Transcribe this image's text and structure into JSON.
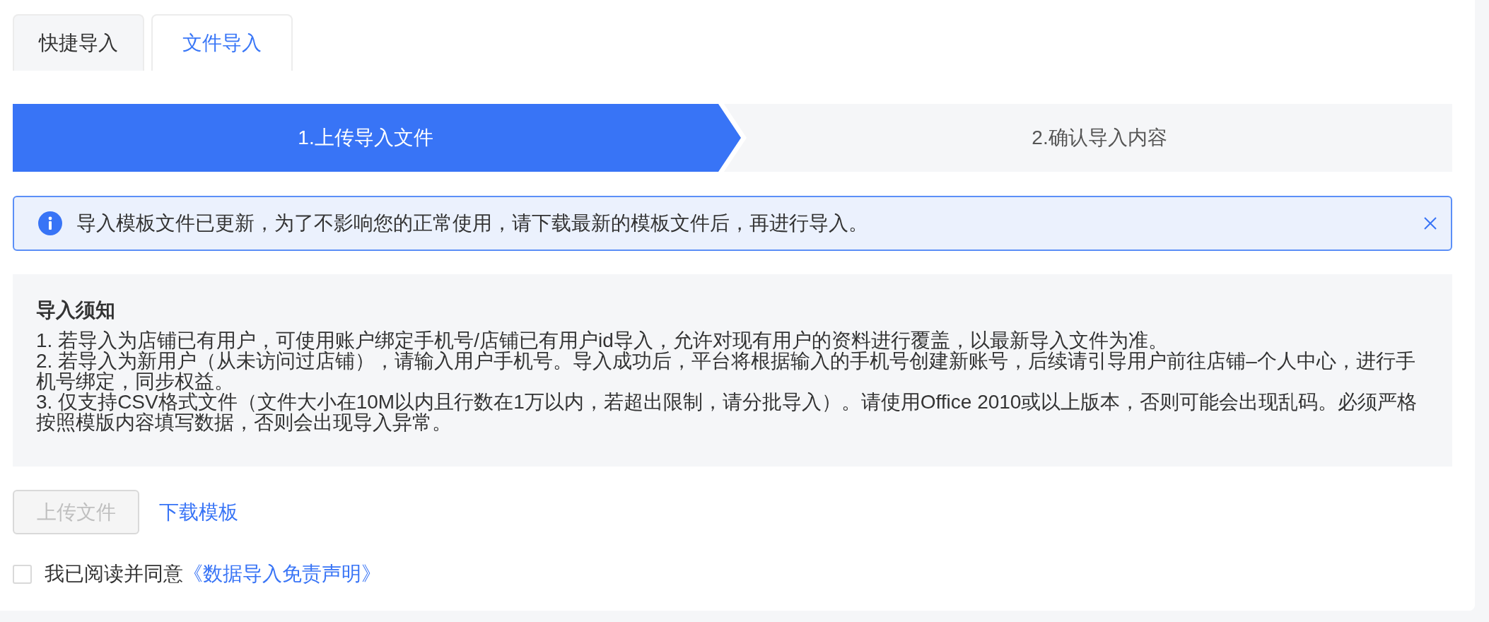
{
  "tabs": [
    {
      "label": "快捷导入",
      "selected": false
    },
    {
      "label": "文件导入",
      "selected": true
    }
  ],
  "steps": [
    {
      "label": "1.上传导入文件",
      "active": true
    },
    {
      "label": "2.确认导入内容",
      "active": false
    }
  ],
  "alert": {
    "message": "导入模板文件已更新，为了不影响您的正常使用，请下载最新的模板文件后，再进行导入。"
  },
  "notice": {
    "title": "导入须知",
    "items": [
      "1. 若导入为店铺已有用户，可使用账户绑定手机号/店铺已有用户id导入，允许对现有用户的资料进行覆盖，以最新导入文件为准。",
      "2. 若导入为新用户（从未访问过店铺），请输入用户手机号。导入成功后，平台将根据输入的手机号创建新账号，后续请引导用户前往店铺–个人中心，进行手机号绑定，同步权益。",
      "3. 仅支持CSV格式文件（文件大小在10M以内且行数在1万以内，若超出限制，请分批导入）。请使用Office 2010或以上版本，否则可能会出现乱码。必须严格按照模版内容填写数据，否则会出现导入异常。"
    ]
  },
  "upload_button": {
    "label": "上传文件",
    "disabled": true
  },
  "download_link": {
    "label": "下载模板"
  },
  "agreement": {
    "checked": false,
    "text": "我已阅读并同意",
    "link": "《数据导入免责声明》"
  }
}
